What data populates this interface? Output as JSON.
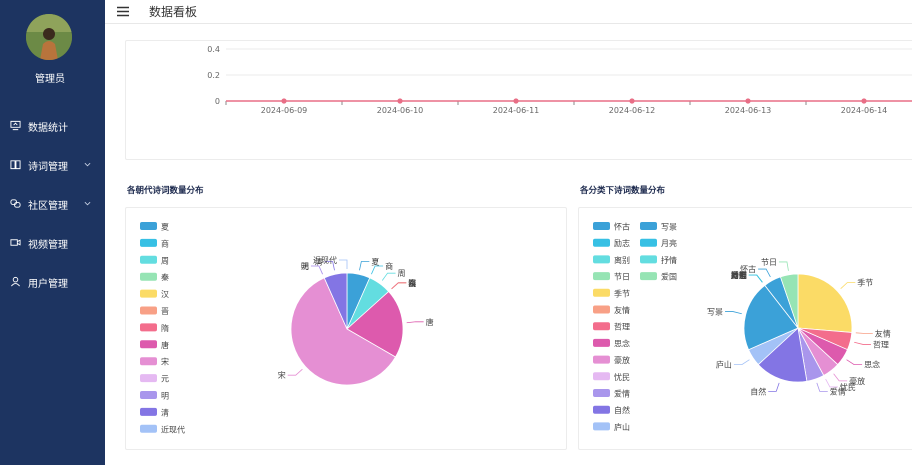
{
  "sidebar": {
    "user_name": "管理员",
    "items": [
      {
        "label": "数据统计",
        "icon": "chart-icon",
        "expandable": false
      },
      {
        "label": "诗词管理",
        "icon": "book-icon",
        "expandable": true
      },
      {
        "label": "社区管理",
        "icon": "link-icon",
        "expandable": true
      },
      {
        "label": "视频管理",
        "icon": "video-icon",
        "expandable": false
      },
      {
        "label": "用户管理",
        "icon": "user-icon",
        "expandable": false
      }
    ]
  },
  "header": {
    "title": "数据看板",
    "menu_icon": "menu-icon"
  },
  "chart_data": [
    {
      "type": "line",
      "x": [
        "2024-06-09",
        "2024-06-10",
        "2024-06-11",
        "2024-06-12",
        "2024-06-13",
        "2024-06-14"
      ],
      "series": [
        {
          "values": [
            0,
            0,
            0,
            0,
            0,
            0
          ]
        }
      ],
      "yticks": [
        "0.4",
        "0.2",
        "0"
      ],
      "ylim": [
        0,
        0.4
      ],
      "color": "#e86e86",
      "grid": true
    },
    {
      "type": "pie",
      "title": "各朝代诗词数量分布",
      "legend_position": "left",
      "slices": [
        {
          "label": "夏",
          "value": 1,
          "color": "#3ba1d8"
        },
        {
          "label": "商",
          "value": 0,
          "color": "#37c0e4"
        },
        {
          "label": "周",
          "value": 1,
          "color": "#63dde0"
        },
        {
          "label": "秦",
          "value": 0,
          "color": "#96e4b4"
        },
        {
          "label": "汉",
          "value": 0,
          "color": "#fbdb66"
        },
        {
          "label": "晋",
          "value": 0,
          "color": "#f8a086"
        },
        {
          "label": "隋",
          "value": 0,
          "color": "#f36d8c"
        },
        {
          "label": "唐",
          "value": 3,
          "color": "#dd5aad"
        },
        {
          "label": "宋",
          "value": 9,
          "color": "#e58fd3"
        },
        {
          "label": "元",
          "value": 0,
          "color": "#e5b9f2"
        },
        {
          "label": "明",
          "value": 0,
          "color": "#a996ec"
        },
        {
          "label": "清",
          "value": 1,
          "color": "#8375e4"
        },
        {
          "label": "近现代",
          "value": 0,
          "color": "#a3c2f7"
        }
      ]
    },
    {
      "type": "pie",
      "title": "各分类下诗词数量分布",
      "legend_position": "left",
      "slices": [
        {
          "label": "季节",
          "value": 5,
          "color": "#fbdb66"
        },
        {
          "label": "友情",
          "value": 0,
          "color": "#f8a086"
        },
        {
          "label": "哲理",
          "value": 1,
          "color": "#f36d8c"
        },
        {
          "label": "思念",
          "value": 1,
          "color": "#dd5aad"
        },
        {
          "label": "豪放",
          "value": 1,
          "color": "#e58fd3"
        },
        {
          "label": "忧民",
          "value": 0,
          "color": "#e5b9f2"
        },
        {
          "label": "爱情",
          "value": 1,
          "color": "#a996ec"
        },
        {
          "label": "自然",
          "value": 3,
          "color": "#8375e4"
        },
        {
          "label": "庐山",
          "value": 1,
          "color": "#a3c2f7"
        },
        {
          "label": "写景",
          "value": 4,
          "color": "#3ba1d8"
        },
        {
          "label": "月亮",
          "value": 0,
          "color": "#37c0e4"
        },
        {
          "label": "抒情",
          "value": 0,
          "color": "#63dde0"
        },
        {
          "label": "爱国",
          "value": 0,
          "color": "#96e4b4"
        },
        {
          "label": "离别",
          "value": 0,
          "color": "#63dde0"
        },
        {
          "label": "励志",
          "value": 0,
          "color": "#37c0e4"
        },
        {
          "label": "怀古",
          "value": 1,
          "color": "#3ba1d8"
        },
        {
          "label": "节日",
          "value": 1,
          "color": "#96e4b4"
        }
      ],
      "legend": [
        [
          "怀古",
          "写景"
        ],
        [
          "励志",
          "月亮"
        ],
        [
          "离别",
          "抒情"
        ],
        [
          "节日",
          "爱国"
        ],
        [
          "季节"
        ],
        [
          "友情"
        ],
        [
          "哲理"
        ],
        [
          "思念"
        ],
        [
          "豪放"
        ],
        [
          "忧民"
        ],
        [
          "爱情"
        ],
        [
          "自然"
        ],
        [
          "庐山"
        ]
      ]
    }
  ]
}
